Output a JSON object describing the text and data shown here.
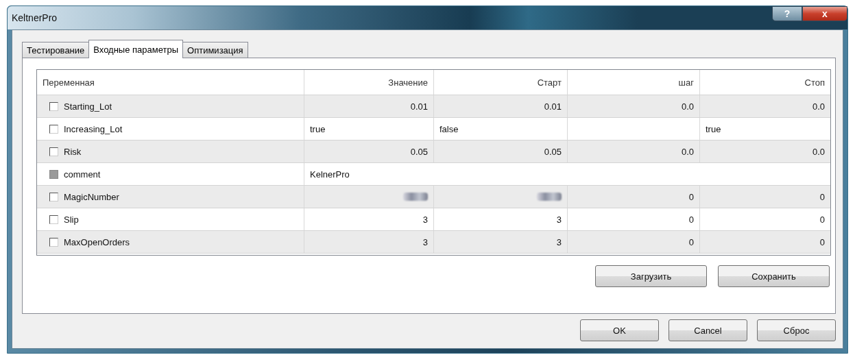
{
  "window": {
    "title": "KeltnerPro",
    "buttons": [
      {
        "kind": "help",
        "label": "?"
      },
      {
        "kind": "close",
        "label": "x"
      }
    ]
  },
  "tabs": [
    {
      "label": "Тестирование",
      "selected": false
    },
    {
      "label": "Входные параметры",
      "selected": true
    },
    {
      "label": "Оптимизация",
      "selected": false
    }
  ],
  "table": {
    "columns": [
      "Переменная",
      "Значение",
      "Старт",
      "шаг",
      "Стоп"
    ],
    "rows": [
      {
        "checked": false,
        "disabled": false,
        "kind": "number",
        "cells": [
          {
            "text": "Starting_Lot"
          },
          {
            "text": "0.01"
          },
          {
            "text": "0.01"
          },
          {
            "text": "0.0"
          },
          {
            "text": "0.0"
          }
        ]
      },
      {
        "checked": false,
        "disabled": false,
        "kind": "text",
        "cells": [
          {
            "text": "Increasing_Lot"
          },
          {
            "text": "true"
          },
          {
            "text": "false"
          },
          {
            "text": ""
          },
          {
            "text": "true"
          }
        ]
      },
      {
        "checked": false,
        "disabled": false,
        "kind": "number",
        "cells": [
          {
            "text": "Risk"
          },
          {
            "text": "0.05"
          },
          {
            "text": "0.05"
          },
          {
            "text": "0.0"
          },
          {
            "text": "0.0"
          }
        ]
      },
      {
        "checked": false,
        "disabled": true,
        "kind": "text",
        "cells": [
          {
            "text": "comment"
          },
          {
            "text": "KelnerPro"
          }
        ]
      },
      {
        "checked": false,
        "disabled": false,
        "kind": "number",
        "cells": [
          {
            "text": "MagicNumber"
          },
          {
            "redacted": true
          },
          {
            "redacted": true
          },
          {
            "text": "0"
          },
          {
            "text": "0"
          }
        ]
      },
      {
        "checked": false,
        "disabled": false,
        "kind": "number",
        "cells": [
          {
            "text": "Slip"
          },
          {
            "text": "3"
          },
          {
            "text": "3"
          },
          {
            "text": "0"
          },
          {
            "text": "0"
          }
        ]
      },
      {
        "checked": false,
        "disabled": false,
        "kind": "number",
        "cells": [
          {
            "text": "MaxOpenOrders"
          },
          {
            "text": "3"
          },
          {
            "text": "3"
          },
          {
            "text": "0"
          },
          {
            "text": "0"
          }
        ]
      }
    ]
  },
  "panel_buttons": [
    "Загрузить",
    "Сохранить"
  ],
  "dialog_buttons": [
    "OK",
    "Cancel",
    "Сброс"
  ]
}
